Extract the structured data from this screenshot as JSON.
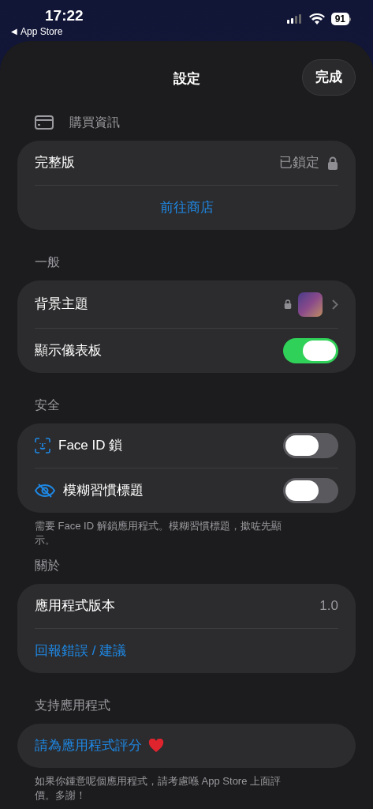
{
  "status_bar": {
    "time": "17:22",
    "back_arrow": "◀",
    "back_label": "App Store",
    "battery": "91"
  },
  "header": {
    "title": "設定",
    "done_button": "完成"
  },
  "sections": [
    {
      "title": "購買資訊",
      "kind": "purchase",
      "rows": [
        {
          "kind": "value",
          "label": "完整版",
          "value": "已鎖定",
          "locked": true
        },
        {
          "kind": "link",
          "label": "前往商店",
          "centered": true
        }
      ]
    },
    {
      "title": "一般",
      "rows": [
        {
          "kind": "theme",
          "label": "背景主題",
          "locked": true
        },
        {
          "kind": "toggle",
          "label": "顯示儀表板",
          "on": true
        }
      ]
    },
    {
      "title": "安全",
      "rows": [
        {
          "kind": "faceid-toggle",
          "label": "Face ID 鎖",
          "on": false
        },
        {
          "kind": "blur-toggle",
          "label": "模糊習慣標題",
          "on": false
        }
      ],
      "footer": "需要 Face ID 解鎖應用程式。模糊習慣標題，撳咗先顯示。"
    },
    {
      "title": "關於",
      "rows": [
        {
          "kind": "value",
          "label": "應用程式版本",
          "value": "1.0",
          "locked": false
        },
        {
          "kind": "link",
          "label": "回報錯誤 / 建議",
          "centered": false
        }
      ]
    },
    {
      "title": "支持應用程式",
      "rows": [
        {
          "kind": "link",
          "label": "請為應用程式評分",
          "centered": false,
          "heart": true
        }
      ],
      "footer": "如果你鍾意呢個應用程式，請考慮喺 App Store 上面評價。多謝！"
    }
  ]
}
